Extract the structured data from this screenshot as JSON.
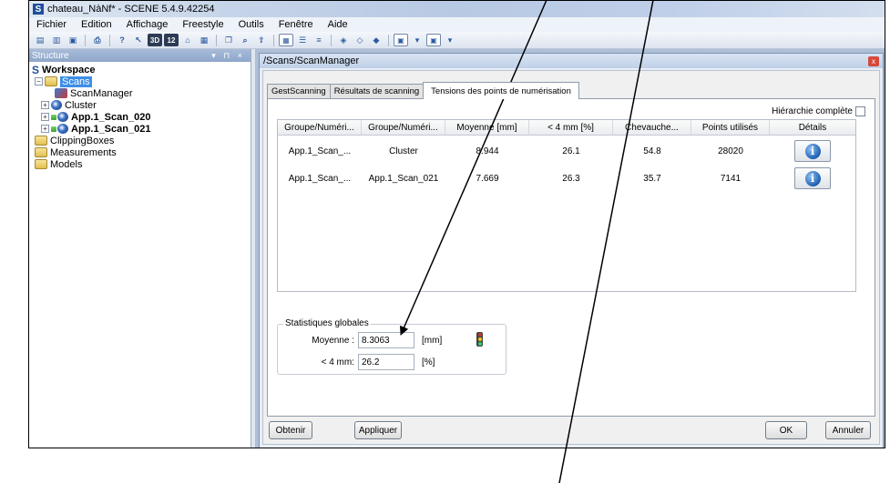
{
  "window": {
    "title": "chateau_NàNf* - SCENE 5.4.9.42254",
    "logo_letter": "S"
  },
  "menu": [
    "Fichier",
    "Edition",
    "Affichage",
    "Freestyle",
    "Outils",
    "Fenêtre",
    "Aide"
  ],
  "toolbar": {
    "btn_3d": "3D",
    "btn_12": "12"
  },
  "structure": {
    "header": "Structure",
    "header_controls": "▾ ⊓ ×",
    "logo_letter": "S",
    "workspace": "Workspace",
    "scans": "Scans",
    "scanmanager": "ScanManager",
    "cluster": "Cluster",
    "scan1": "App.1_Scan_020",
    "scan2": "App.1_Scan_021",
    "clippingboxes": "ClippingBoxes",
    "measurements": "Measurements",
    "models": "Models"
  },
  "dialog": {
    "title": "/Scans/ScanManager",
    "close": "x",
    "tabs": [
      "GestScanning",
      "Résultats de scanning",
      "Tensions des points de numérisation"
    ],
    "hierarchy_label": "Hiérarchie complète",
    "columns": [
      "Groupe/Numéri...",
      "Groupe/Numéri...",
      "Moyenne [mm]",
      "< 4 mm [%]",
      "Chevauche...",
      "Points utilisés",
      "Détails"
    ],
    "rows": [
      {
        "c1": "App.1_Scan_...",
        "c2": "Cluster",
        "c3": "8.944",
        "c4": "26.1",
        "c5": "54.8",
        "c6": "28020"
      },
      {
        "c1": "App.1_Scan_...",
        "c2": "App.1_Scan_021",
        "c3": "7.669",
        "c4": "26.3",
        "c5": "35.7",
        "c6": "7141"
      }
    ],
    "info_glyph": "i",
    "stats": {
      "legend": "Statistiques globales",
      "mean_label": "Moyenne :",
      "mean_value": "8.3063",
      "mean_unit": "[mm]",
      "lt4_label": "< 4 mm:",
      "lt4_value": "26.2",
      "lt4_unit": "[%]"
    },
    "buttons": {
      "obtenir": "Obtenir",
      "appliquer": "Appliquer",
      "ok": "OK",
      "annuler": "Annuler"
    }
  },
  "colors": {
    "selection": "#3d8ee6",
    "traffic_red": "#c0392b",
    "traffic_yellow": "#f1c40f",
    "traffic_green": "#2ecc71"
  }
}
